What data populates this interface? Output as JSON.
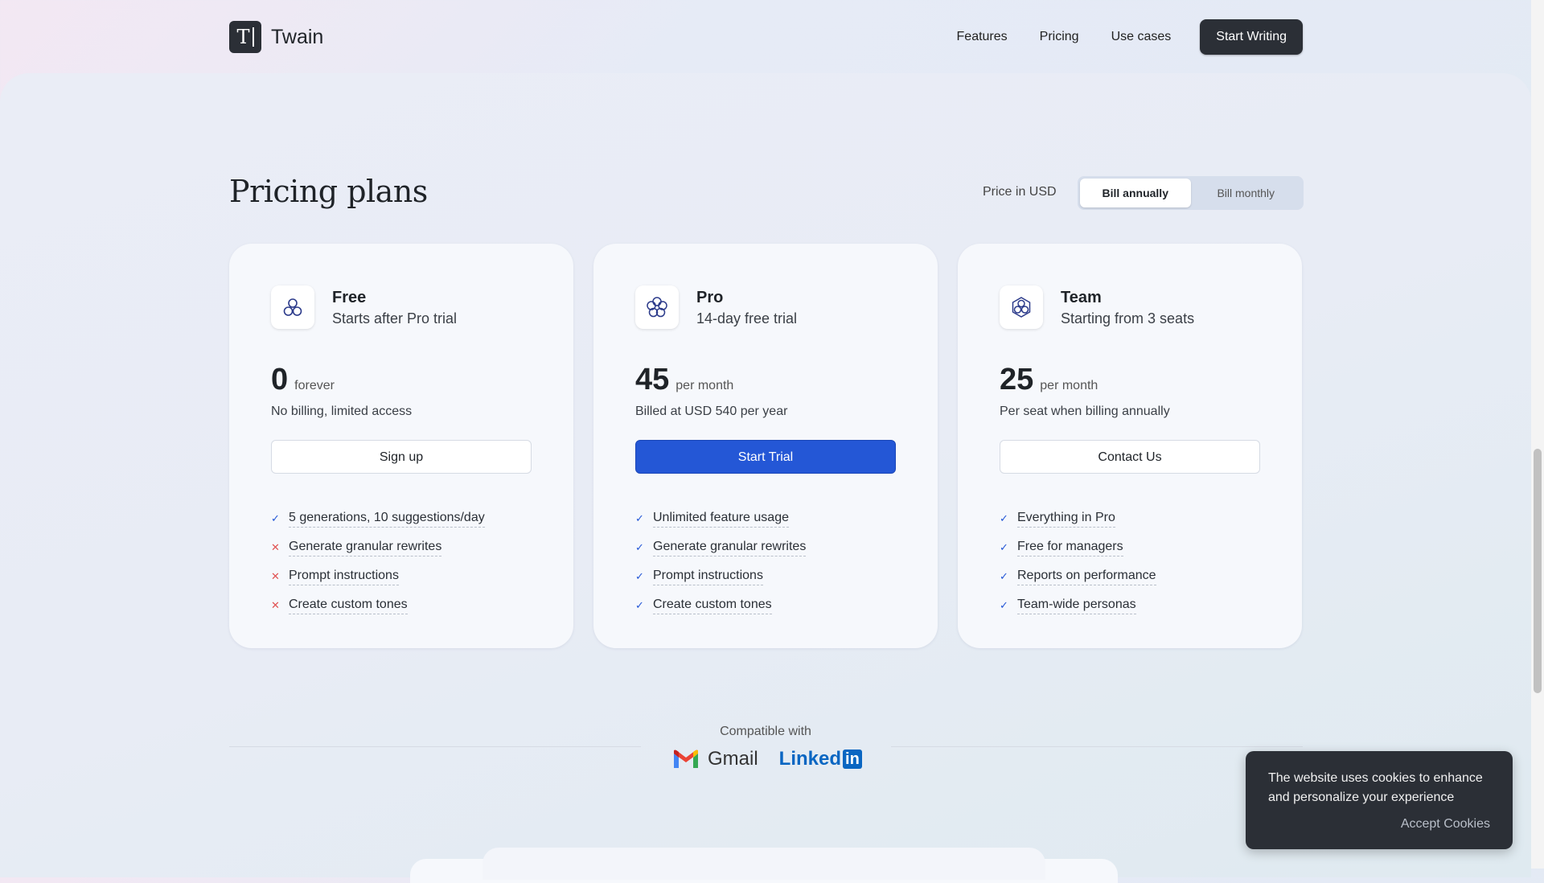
{
  "brand": {
    "name": "Twain",
    "logo_letter": "T"
  },
  "nav": {
    "links": [
      "Features",
      "Pricing",
      "Use cases"
    ],
    "cta": "Start Writing"
  },
  "pricing": {
    "title": "Pricing plans",
    "currency_label": "Price in USD",
    "billing_toggle": {
      "options": [
        "Bill annually",
        "Bill monthly"
      ],
      "selected": "Bill annually"
    },
    "plans": [
      {
        "name": "Free",
        "subtitle": "Starts after Pro trial",
        "price": "0",
        "period": "forever",
        "note": "No billing, limited access",
        "button": "Sign up",
        "features": [
          {
            "text": "5 generations, 10 suggestions/day",
            "included": true,
            "mark": "✓"
          },
          {
            "text": "Generate granular rewrites",
            "included": false,
            "mark": "✕"
          },
          {
            "text": "Prompt instructions",
            "included": false,
            "mark": "✕"
          },
          {
            "text": "Create custom tones",
            "included": false,
            "mark": "✕"
          }
        ]
      },
      {
        "name": "Pro",
        "subtitle": "14-day free trial",
        "price": "45",
        "period": "per month",
        "note": "Billed at USD 540 per year",
        "button": "Start Trial",
        "features": [
          {
            "text": "Unlimited feature usage",
            "included": true,
            "mark": "✓"
          },
          {
            "text": "Generate granular rewrites",
            "included": true,
            "mark": "✓"
          },
          {
            "text": "Prompt instructions",
            "included": true,
            "mark": "✓"
          },
          {
            "text": "Create custom tones",
            "included": true,
            "mark": "✓"
          }
        ]
      },
      {
        "name": "Team",
        "subtitle": "Starting from 3 seats",
        "price": "25",
        "period": "per month",
        "note": "Per seat when billing annually",
        "button": "Contact Us",
        "features": [
          {
            "text": "Everything in Pro",
            "included": true,
            "mark": "✓"
          },
          {
            "text": "Free for managers",
            "included": true,
            "mark": "✓"
          },
          {
            "text": "Reports on performance",
            "included": true,
            "mark": "✓"
          },
          {
            "text": "Team-wide personas",
            "included": true,
            "mark": "✓"
          }
        ]
      }
    ]
  },
  "compatibility": {
    "label": "Compatible with",
    "brands": [
      "Gmail",
      "Linked",
      "in"
    ]
  },
  "cookie_banner": {
    "message": "The website uses cookies to enhance and personalize your experience",
    "button": "Accept Cookies"
  },
  "colors": {
    "primary": "#2457d6",
    "dark": "#2b2f36",
    "check": "#2457d6",
    "cross": "#e05252"
  }
}
